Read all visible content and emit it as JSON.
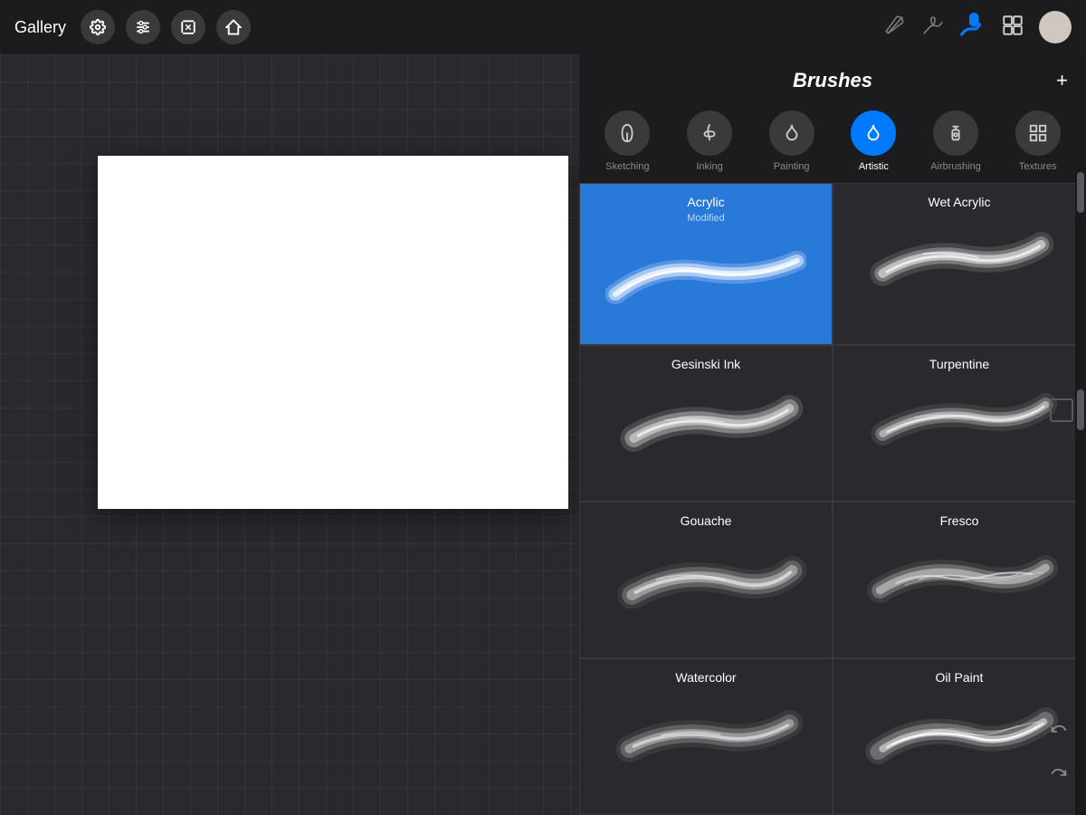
{
  "toolbar": {
    "gallery_label": "Gallery",
    "add_label": "+",
    "tools": {
      "pen_label": "Pen",
      "brush_label": "Brush",
      "eraser_label": "Eraser",
      "layers_label": "Layers"
    }
  },
  "brush_panel": {
    "title": "Brushes",
    "categories": [
      {
        "id": "sketching",
        "label": "Sketching",
        "icon": "✏️",
        "active": false
      },
      {
        "id": "inking",
        "label": "Inking",
        "icon": "🖊️",
        "active": false
      },
      {
        "id": "painting",
        "label": "Painting",
        "icon": "💧",
        "active": false
      },
      {
        "id": "artistic",
        "label": "Artistic",
        "icon": "🎨",
        "active": true
      },
      {
        "id": "airbrushing",
        "label": "Airbrushing",
        "icon": "💨",
        "active": false
      },
      {
        "id": "textures",
        "label": "Textures",
        "icon": "⬛",
        "active": false
      }
    ],
    "brushes": [
      {
        "id": "acrylic",
        "name": "Acrylic",
        "subtitle": "Modified",
        "selected": true,
        "stroke_color": "#c8d8f8"
      },
      {
        "id": "wet_acrylic",
        "name": "Wet Acrylic",
        "subtitle": "",
        "selected": false,
        "stroke_color": "#c0c0c0"
      },
      {
        "id": "gesinski_ink",
        "name": "Gesinski Ink",
        "subtitle": "",
        "selected": false,
        "stroke_color": "#c0c0c0"
      },
      {
        "id": "turpentine",
        "name": "Turpentine",
        "subtitle": "",
        "selected": false,
        "stroke_color": "#b0b0b0"
      },
      {
        "id": "gouache",
        "name": "Gouache",
        "subtitle": "",
        "selected": false,
        "stroke_color": "#a0a0a0"
      },
      {
        "id": "fresco",
        "name": "Fresco",
        "subtitle": "",
        "selected": false,
        "stroke_color": "#b8b8b8"
      },
      {
        "id": "watercolor",
        "name": "Watercolor",
        "subtitle": "",
        "selected": false,
        "stroke_color": "#a8a8a8"
      },
      {
        "id": "oil_paint",
        "name": "Oil Paint",
        "subtitle": "",
        "selected": false,
        "stroke_color": "#c8c8c8"
      }
    ]
  }
}
